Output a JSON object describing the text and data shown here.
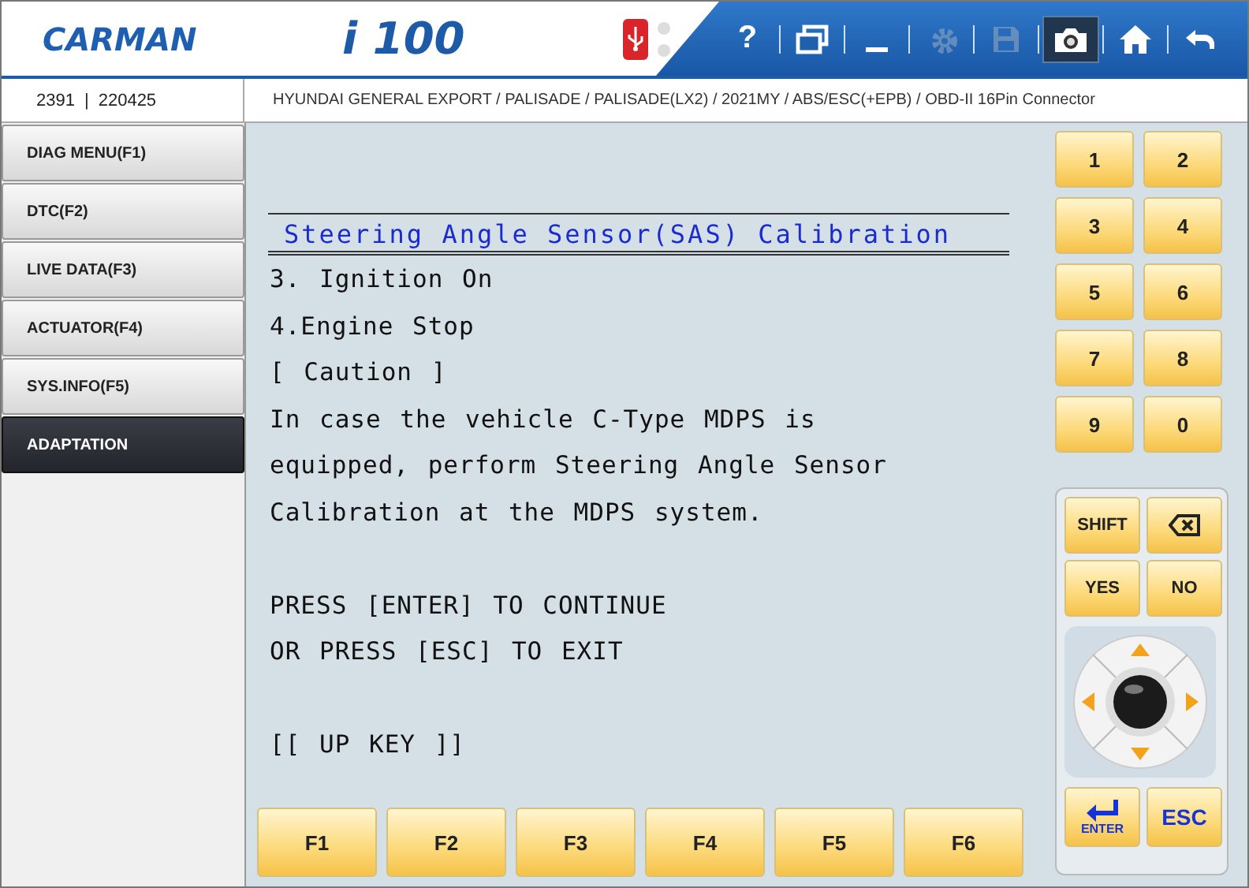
{
  "header": {
    "brand": "CARMAN",
    "model": "i 100",
    "usb_connected": true,
    "toolbar": [
      {
        "kind": "help",
        "label": "?",
        "selected": false,
        "disabled": false
      },
      {
        "kind": "windows",
        "selected": false,
        "disabled": false
      },
      {
        "kind": "minimize",
        "selected": false,
        "disabled": false
      },
      {
        "kind": "settings",
        "selected": false,
        "disabled": true
      },
      {
        "kind": "save",
        "selected": false,
        "disabled": true
      },
      {
        "kind": "camera",
        "selected": true,
        "disabled": false
      },
      {
        "kind": "home",
        "selected": false,
        "disabled": false
      },
      {
        "kind": "back",
        "selected": false,
        "disabled": false
      }
    ]
  },
  "info": {
    "code": "2391",
    "separator": "|",
    "version": "220425",
    "path": "HYUNDAI GENERAL EXPORT / PALISADE / PALISADE(LX2) / 2021MY / ABS/ESC(+EPB) / OBD-II 16Pin Connector"
  },
  "sidebar": {
    "items": [
      {
        "label": "DIAG MENU(F1)",
        "selected": false
      },
      {
        "label": "DTC(F2)",
        "selected": false
      },
      {
        "label": "LIVE DATA(F3)",
        "selected": false
      },
      {
        "label": "ACTUATOR(F4)",
        "selected": false
      },
      {
        "label": "SYS.INFO(F5)",
        "selected": false
      },
      {
        "label": "ADAPTATION",
        "selected": true
      }
    ]
  },
  "screen": {
    "title": "Steering Angle Sensor(SAS) Calibration",
    "paragraphs": [
      [
        "3. Ignition On",
        "4.Engine Stop",
        "[ Caution ]",
        "In case the vehicle C-Type MDPS is",
        "equipped, perform Steering Angle Sensor",
        "Calibration at the MDPS system."
      ],
      [
        "PRESS [ENTER] TO CONTINUE",
        "OR PRESS [ESC] TO EXIT"
      ],
      [
        "[[ UP KEY ]]"
      ]
    ]
  },
  "function_keys": [
    "F1",
    "F2",
    "F3",
    "F4",
    "F5",
    "F6"
  ],
  "number_keys": [
    "1",
    "2",
    "3",
    "4",
    "5",
    "6",
    "7",
    "8",
    "9",
    "0"
  ],
  "control_keys": [
    {
      "kind": "text",
      "label": "SHIFT"
    },
    {
      "kind": "backspace"
    },
    {
      "kind": "text",
      "label": "YES"
    },
    {
      "kind": "text",
      "label": "NO"
    }
  ],
  "bottom_keys": [
    {
      "kind": "enter",
      "label": "ENTER"
    },
    {
      "kind": "text",
      "label": "ESC"
    }
  ]
}
